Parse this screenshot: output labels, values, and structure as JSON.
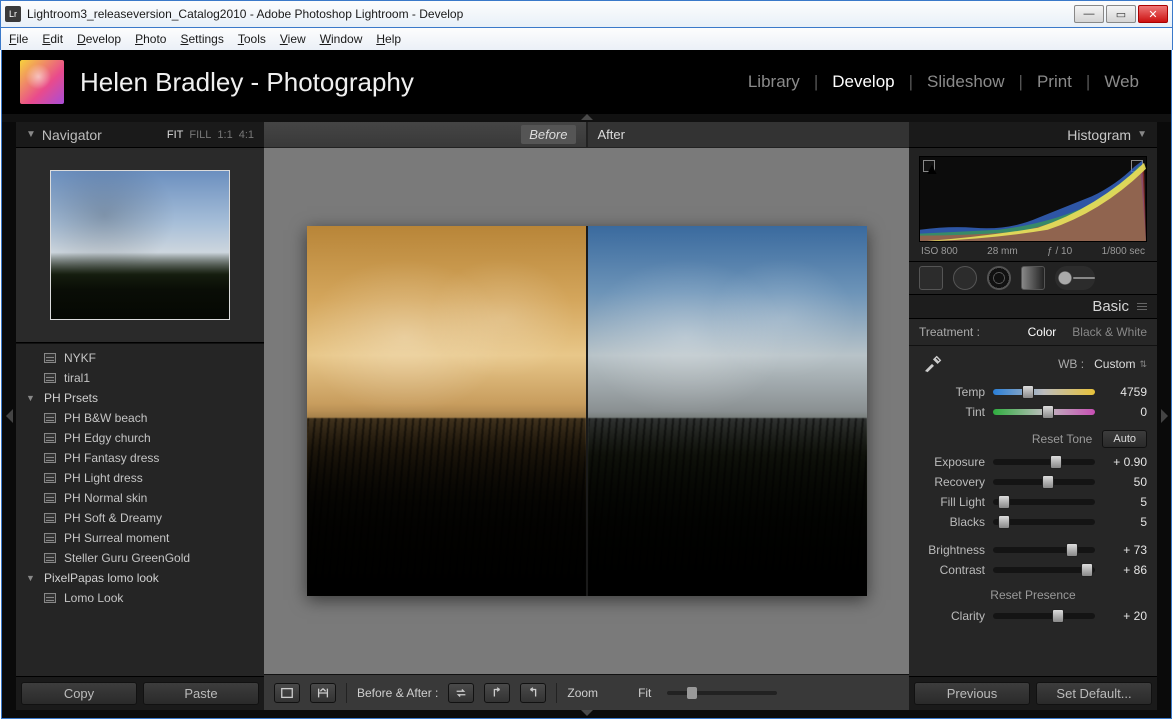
{
  "window": {
    "title": "Lightroom3_releaseversion_Catalog2010 - Adobe Photoshop Lightroom - Develop",
    "app_abbrev": "Lr"
  },
  "menubar": [
    "File",
    "Edit",
    "Develop",
    "Photo",
    "Settings",
    "Tools",
    "View",
    "Window",
    "Help"
  ],
  "identity": {
    "title": "Helen Bradley - Photography"
  },
  "modules": {
    "items": [
      "Library",
      "Develop",
      "Slideshow",
      "Print",
      "Web"
    ],
    "active": "Develop"
  },
  "navigator": {
    "title": "Navigator",
    "zoom_options": [
      "FIT",
      "FILL",
      "1:1",
      "4:1"
    ],
    "zoom_selected": "FIT"
  },
  "presets": {
    "items": [
      {
        "type": "item",
        "label": "NYKF"
      },
      {
        "type": "item",
        "label": "tiral1"
      },
      {
        "type": "folder",
        "label": "PH Prsets",
        "open": true
      },
      {
        "type": "item",
        "label": "PH B&W beach"
      },
      {
        "type": "item",
        "label": "PH Edgy church"
      },
      {
        "type": "item",
        "label": "PH Fantasy dress"
      },
      {
        "type": "item",
        "label": "PH Light dress"
      },
      {
        "type": "item",
        "label": "PH Normal skin"
      },
      {
        "type": "item",
        "label": "PH Soft & Dreamy"
      },
      {
        "type": "item",
        "label": "PH Surreal moment"
      },
      {
        "type": "item",
        "label": "Steller Guru GreenGold"
      },
      {
        "type": "folder",
        "label": "PixelPapas lomo look",
        "open": true
      },
      {
        "type": "item",
        "label": "Lomo Look"
      }
    ]
  },
  "left_footer": {
    "copy": "Copy",
    "paste": "Paste"
  },
  "center": {
    "before_label": "Before",
    "after_label": "After",
    "toolbar": {
      "ba_label": "Before & After :",
      "zoom_label": "Zoom",
      "fit_label": "Fit"
    }
  },
  "right": {
    "histogram": {
      "title": "Histogram",
      "iso": "ISO 800",
      "focal": "28 mm",
      "aperture": "ƒ / 10",
      "shutter": "1/800 sec"
    },
    "basic": {
      "title": "Basic",
      "treatment_label": "Treatment :",
      "treatment_color": "Color",
      "treatment_bw": "Black & White",
      "wb_label": "WB :",
      "wb_value": "Custom",
      "temp_label": "Temp",
      "temp_value": "4759",
      "tint_label": "Tint",
      "tint_value": "0",
      "reset_tone": "Reset Tone",
      "auto": "Auto",
      "exposure_label": "Exposure",
      "exposure_value": "+ 0.90",
      "recovery_label": "Recovery",
      "recovery_value": "50",
      "fill_label": "Fill Light",
      "fill_value": "5",
      "blacks_label": "Blacks",
      "blacks_value": "5",
      "brightness_label": "Brightness",
      "brightness_value": "+ 73",
      "contrast_label": "Contrast",
      "contrast_value": "+ 86",
      "reset_presence": "Reset Presence",
      "clarity_label": "Clarity",
      "clarity_value": "+ 20"
    },
    "footer": {
      "previous": "Previous",
      "set_default": "Set Default..."
    }
  }
}
